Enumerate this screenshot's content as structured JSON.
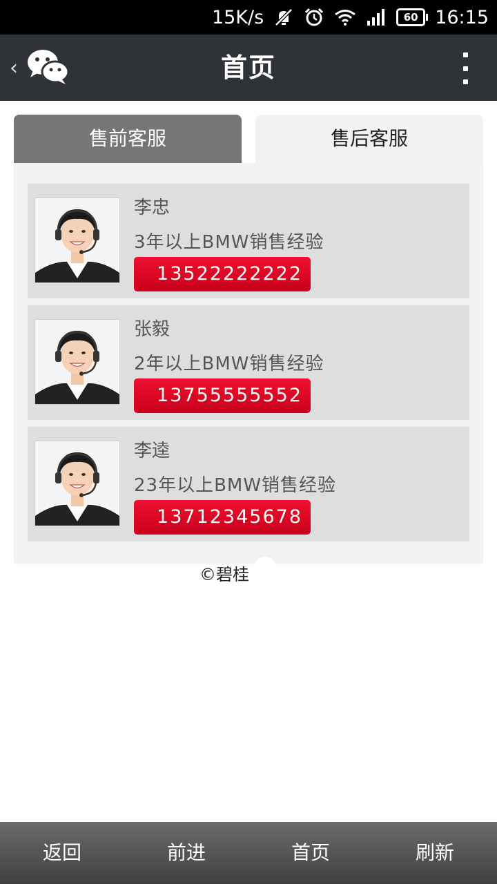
{
  "status_bar": {
    "net_speed": "15K/s",
    "battery": "60",
    "time": "16:15",
    "icons": [
      "notifications-muted-icon",
      "alarm-icon",
      "wifi-icon",
      "signal-icon",
      "battery-icon"
    ]
  },
  "title_bar": {
    "title": "首页",
    "back_icon": "chevron-left-icon",
    "app_icon": "wechat-icon",
    "more_icon": "more-vertical-icon"
  },
  "tabs": [
    {
      "label": "售前客服",
      "active": false
    },
    {
      "label": "售后客服",
      "active": true
    }
  ],
  "contacts": [
    {
      "name": "李忠",
      "experience": "3年以上BMW销售经验",
      "phone": "13522222222"
    },
    {
      "name": "张毅",
      "experience": "2年以上BMW销售经验",
      "phone": "13755555552"
    },
    {
      "name": "李逵",
      "experience": "23年以上BMW销售经验",
      "phone": "13712345678"
    }
  ],
  "footer": {
    "copyright": "©碧桂"
  },
  "bottom_nav": [
    {
      "label": "返回"
    },
    {
      "label": "前进"
    },
    {
      "label": "首页"
    },
    {
      "label": "刷新"
    }
  ],
  "colors": {
    "title_bar": "#2f3236",
    "tab_inactive": "#767676",
    "panel": "#f1f3f2",
    "card": "#dedede",
    "phone_button": "#e2001f"
  }
}
